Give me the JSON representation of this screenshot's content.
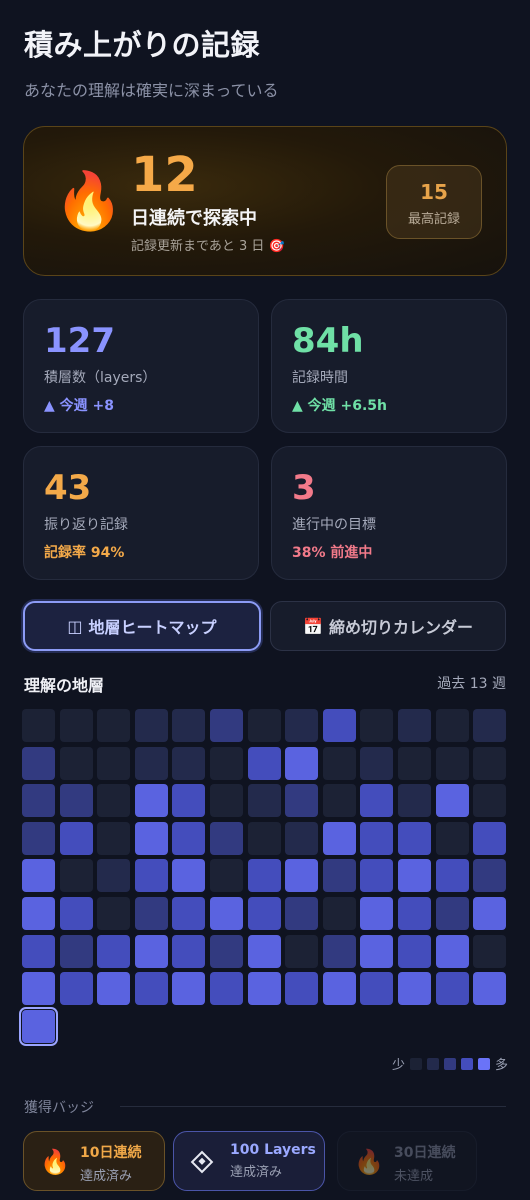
{
  "header": {
    "title": "積み上がりの記録",
    "subtitle": "あなたの理解は確実に深まっている"
  },
  "streak": {
    "icon": "fire-icon",
    "count": "12",
    "label": "日連続で探索中",
    "sub": "記録更新まであと 3 日 🎯",
    "best_value": "15",
    "best_label": "最高記録"
  },
  "stats": [
    {
      "value": "127",
      "label": "積層数（layers）",
      "delta": "▲ 今週 +8",
      "color": "#8a93ff",
      "delta_color": "#8a93ff"
    },
    {
      "value": "84h",
      "label": "記録時間",
      "delta": "▲ 今週 +6.5h",
      "color": "#6fe0a6",
      "delta_color": "#6fe0a6"
    },
    {
      "value": "43",
      "label": "振り返り記録",
      "delta": "記録率 94%",
      "color": "#f3a949",
      "delta_color": "#f3a949"
    },
    {
      "value": "3",
      "label": "進行中の目標",
      "delta": "38% 前進中",
      "color": "#f27a8a",
      "delta_color": "#f27a8a"
    }
  ],
  "tabs": [
    {
      "icon": "◫",
      "label": "地層ヒートマップ",
      "active": true
    },
    {
      "icon": "📅",
      "label": "締め切りカレンダー",
      "active": false
    }
  ],
  "heatmap": {
    "title": "理解の地層",
    "range_label": "過去 13 週",
    "legend_low": "少",
    "legend_high": "多",
    "level_colors": [
      "#1c2235",
      "#232a4c",
      "#323a80",
      "#444dbc",
      "#5a63e0",
      "#6a73f8"
    ],
    "rows": [
      [
        0,
        0,
        0,
        1,
        1,
        2,
        0,
        1,
        3,
        0,
        1,
        0,
        1
      ],
      [
        2,
        0,
        0,
        1,
        1,
        0,
        3,
        4,
        0,
        1,
        0,
        0,
        0
      ],
      [
        2,
        2,
        0,
        4,
        3,
        0,
        1,
        2,
        0,
        3,
        1,
        4,
        0
      ],
      [
        2,
        3,
        0,
        4,
        3,
        2,
        0,
        1,
        4,
        3,
        3,
        0,
        3
      ],
      [
        4,
        0,
        1,
        3,
        4,
        0,
        3,
        4,
        2,
        3,
        4,
        3,
        2
      ],
      [
        4,
        3,
        0,
        2,
        3,
        4,
        3,
        2,
        0,
        4,
        3,
        2,
        4
      ],
      [
        3,
        2,
        3,
        4,
        3,
        2,
        4,
        0,
        2,
        4,
        3,
        4,
        0
      ],
      [
        4,
        3,
        4,
        3,
        4,
        3,
        4,
        3,
        4,
        3,
        4,
        3,
        4
      ],
      [
        4
      ]
    ],
    "today": {
      "row": 8,
      "col": 0
    }
  },
  "badges_section": {
    "title": "獲得バッジ",
    "items": [
      {
        "icon": "🔥",
        "name": "10日連続",
        "status": "達成済み"
      },
      {
        "icon": "diamond-icon",
        "name": "100 Layers",
        "status": "達成済み"
      },
      {
        "icon": "🔥",
        "name": "30日連続",
        "status": "未達成"
      }
    ]
  }
}
